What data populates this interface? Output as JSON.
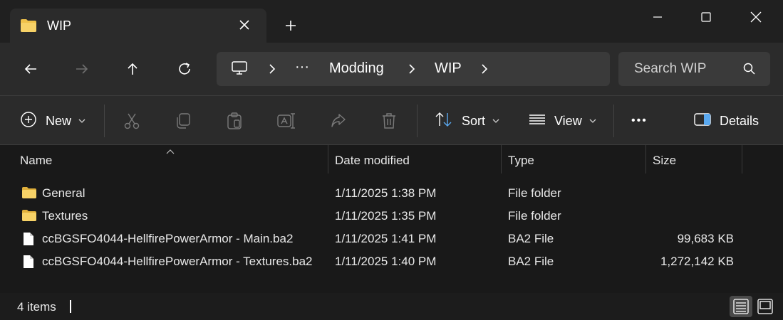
{
  "window": {
    "tab_title": "WIP",
    "new_tab_icon": "plus-icon",
    "controls": [
      "minimize-icon",
      "maximize-icon",
      "close-icon"
    ]
  },
  "navigation": {
    "breadcrumb": [
      "Modding",
      "WIP"
    ],
    "overflow_label": "···",
    "search_placeholder": "Search WIP"
  },
  "commands": {
    "new_label": "New",
    "sort_label": "Sort",
    "view_label": "View",
    "more_label": "•••",
    "details_label": "Details"
  },
  "columns": {
    "name": "Name",
    "date": "Date modified",
    "type": "Type",
    "size": "Size"
  },
  "files": [
    {
      "name": "General",
      "date": "1/11/2025 1:38 PM",
      "type": "File folder",
      "size": "",
      "icon": "folder-icon"
    },
    {
      "name": "Textures",
      "date": "1/11/2025 1:35 PM",
      "type": "File folder",
      "size": "",
      "icon": "folder-icon"
    },
    {
      "name": "ccBGSFO4044-HellfirePowerArmor - Main.ba2",
      "date": "1/11/2025 1:41 PM",
      "type": "BA2 File",
      "size": "99,683 KB",
      "icon": "file-icon"
    },
    {
      "name": "ccBGSFO4044-HellfirePowerArmor - Textures.ba2",
      "date": "1/11/2025 1:40 PM",
      "type": "BA2 File",
      "size": "1,272,142 KB",
      "icon": "file-icon"
    }
  ],
  "status": {
    "item_count": "4 items"
  },
  "colors": {
    "folder": "#f0c24a",
    "background": "#191919",
    "toolbar": "#2b2b2b"
  }
}
